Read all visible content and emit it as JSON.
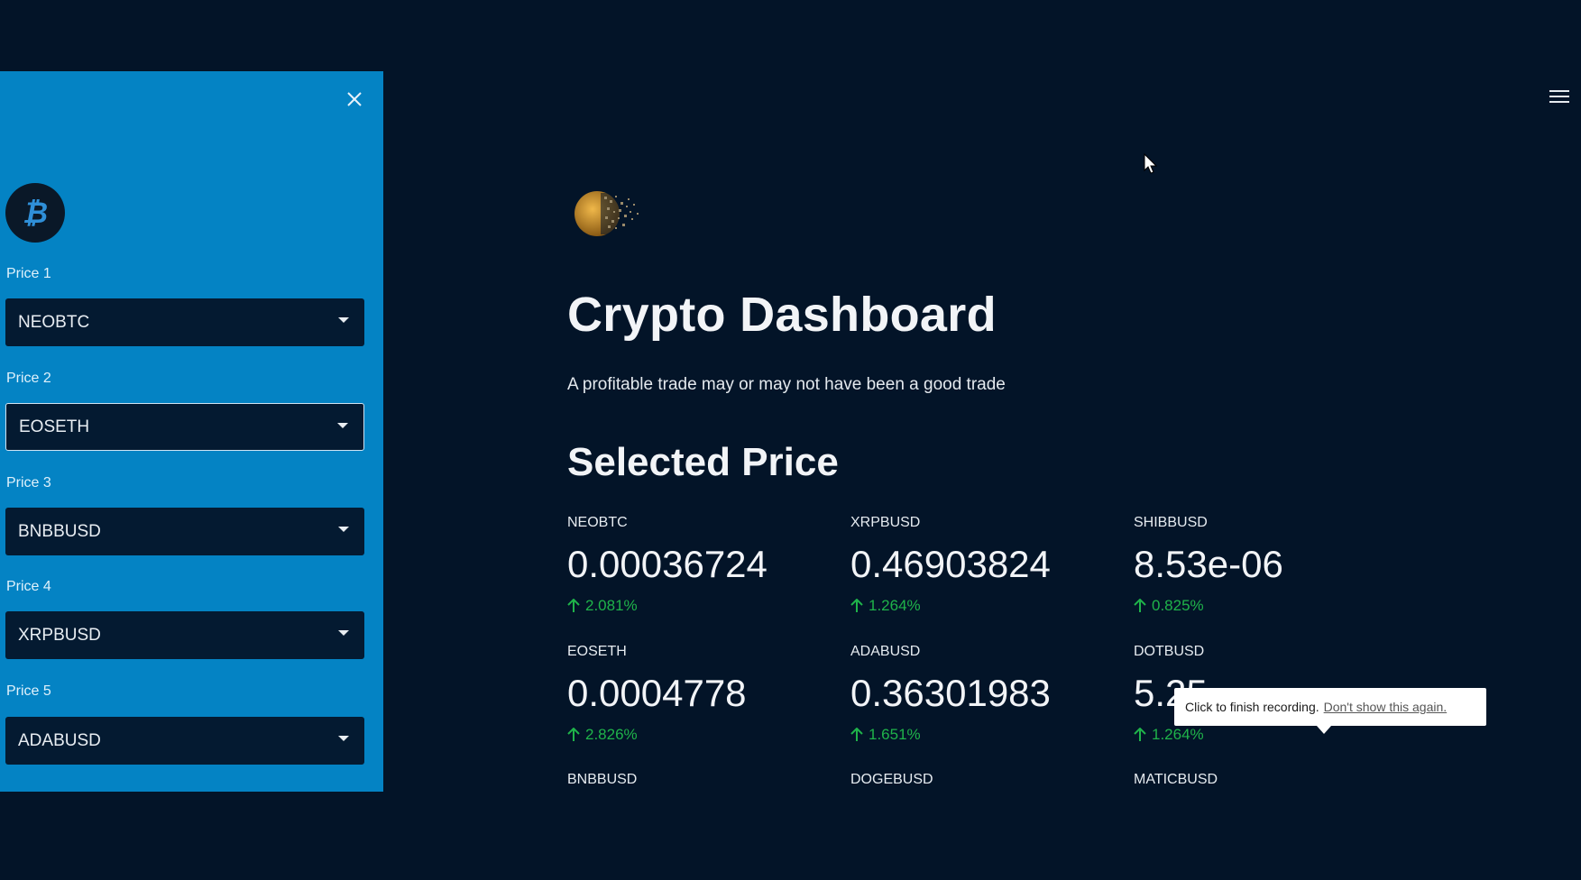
{
  "sidebar": {
    "close_icon": "close-icon",
    "logo_icon": "bitcoin-logo",
    "selectors": [
      {
        "label": "Price 1",
        "value": "NEOBTC"
      },
      {
        "label": "Price 2",
        "value": "EOSETH"
      },
      {
        "label": "Price 3",
        "value": "BNBBUSD"
      },
      {
        "label": "Price 4",
        "value": "XRPBUSD"
      },
      {
        "label": "Price 5",
        "value": "ADABUSD"
      }
    ]
  },
  "header": {
    "menu_icon": "hamburger-menu-icon"
  },
  "main": {
    "title": "Crypto Dashboard",
    "subtitle": "A profitable trade may or may not have been a good trade",
    "section_title": "Selected Price",
    "metrics": [
      {
        "symbol": "NEOBTC",
        "price": "0.00036724",
        "change": "2.081%"
      },
      {
        "symbol": "XRPBUSD",
        "price": "0.46903824",
        "change": "1.264%"
      },
      {
        "symbol": "SHIBBUSD",
        "price": "8.53e-06",
        "change": "0.825%"
      },
      {
        "symbol": "EOSETH",
        "price": "0.0004778",
        "change": "2.826%"
      },
      {
        "symbol": "ADABUSD",
        "price": "0.36301983",
        "change": "1.651%"
      },
      {
        "symbol": "DOTBUSD",
        "price": "5.25",
        "change": "1.264%"
      },
      {
        "symbol": "BNBBUSD",
        "price": "",
        "change": ""
      },
      {
        "symbol": "DOGEBUSD",
        "price": "",
        "change": ""
      },
      {
        "symbol": "MATICBUSD",
        "price": "",
        "change": ""
      }
    ]
  },
  "tooltip": {
    "text": "Click to finish recording.",
    "link": "Don't show this again."
  },
  "colors": {
    "background": "#031428",
    "sidebar": "#0483c4",
    "select_bg": "#041a31",
    "positive": "#1fb34a"
  }
}
